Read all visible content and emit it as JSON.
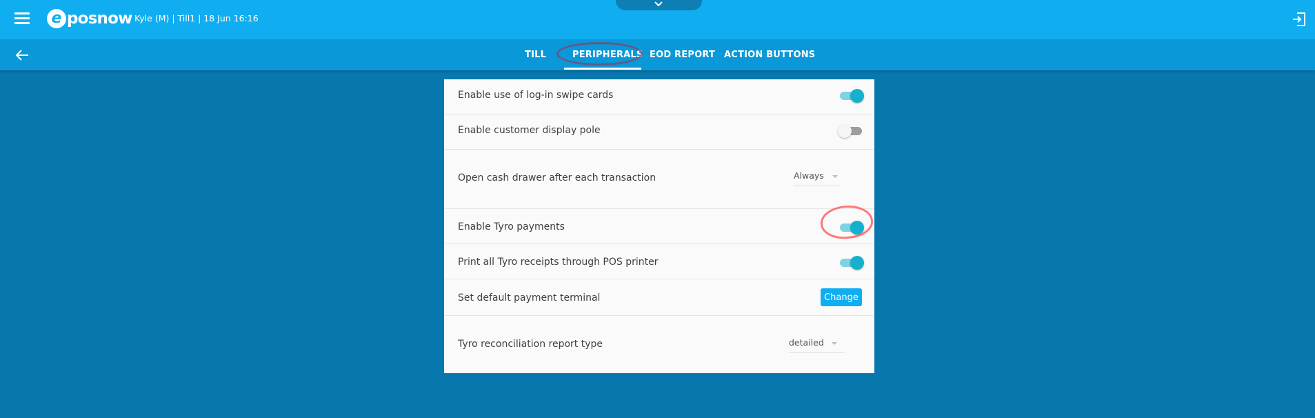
{
  "header": {
    "logo_mark": "e",
    "logo_text": "posnow",
    "session_info": "Kyle (M) | Till1 | 18 Jun 16:16",
    "icons": {
      "menu": "hamburger-icon",
      "pull_down": "chevron-down-icon",
      "logout": "exit-icon"
    }
  },
  "nav": {
    "back_icon": "arrow-left-icon",
    "tabs": [
      {
        "label": "TILL"
      },
      {
        "label": "PERIPHERALS",
        "active": true
      },
      {
        "label": "EOD REPORT"
      },
      {
        "label": "ACTION BUTTONS"
      }
    ]
  },
  "settings": {
    "swipe_cards": {
      "label": "Enable use of log-in swipe cards",
      "enabled": true
    },
    "display_pole": {
      "label": "Enable customer display pole",
      "enabled": false
    },
    "cash_drawer": {
      "label": "Open cash drawer after each transaction",
      "value": "Always"
    },
    "tyro_payments": {
      "label": "Enable Tyro payments",
      "enabled": true
    },
    "tyro_receipts": {
      "label": "Print all Tyro receipts through POS printer",
      "enabled": true
    },
    "payment_terminal": {
      "label": "Set default payment terminal",
      "button_label": "Change"
    },
    "reconciliation": {
      "label": "Tyro reconciliation report type",
      "value": "detailed"
    }
  },
  "colors": {
    "header": "#10aef0",
    "nav": "#0a98d8",
    "background": "#0877ad",
    "toggle_on": "#16b0cf",
    "annotation_tab": "#80466e",
    "annotation_toggle": "#ff5f5f"
  }
}
